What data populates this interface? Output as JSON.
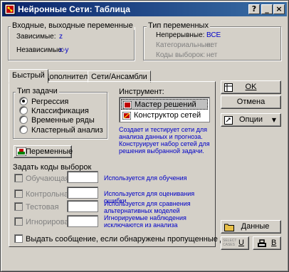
{
  "window": {
    "title": "Нейронные Сети: Таблица",
    "help": "?",
    "minimize": "_",
    "close": "×"
  },
  "variables": {
    "title": "Входные, выходные переменные",
    "dependent_label": "Зависимые:",
    "dependent_value": "z",
    "independent_label": "Независимые:",
    "independent_value": "x-y"
  },
  "var_types": {
    "title": "Тип переменных",
    "continuous_label": "Непрерывные:",
    "continuous_value": "ВСЕ",
    "categorical_label": "Категориальные:",
    "categorical_value": "нет",
    "codes_label": "Коды выборок:",
    "codes_value": "нет"
  },
  "tabs": [
    "Быстрый",
    "Дополнительно",
    "Сети/Ансамбли"
  ],
  "task": {
    "title": "Тип задачи",
    "options": [
      "Регрессия",
      "Классификация",
      "Временные ряды",
      "Кластерный анализ"
    ],
    "selected": "Регрессия"
  },
  "tool": {
    "label": "Инструмент:",
    "items": [
      "Мастер решений",
      "Конструктор сетей"
    ],
    "selected": "Мастер решений",
    "description": "Создает и тестирует сети для анализа данных и прогноза. Конструирует набор сетей для решения выбранной задачи."
  },
  "variables_button": "Переменные",
  "codes": {
    "title": "Задать коды выборок",
    "rows": [
      {
        "label": "Обучающая",
        "hint": "Используется для обучения"
      },
      {
        "label": "Контрольная",
        "hint": "Используется для оценивания ошибки"
      },
      {
        "label": "Тестовая",
        "hint": "Используется для сравнения альтернативных моделей"
      },
      {
        "label": "Игнорировать",
        "hint": "Игнорируемые наблюдения исключаются из анализа"
      }
    ]
  },
  "missing_check": "Выдать сообщение, если обнаружены пропущенные данные",
  "buttons": {
    "ok": "OK",
    "cancel": "Отмена",
    "options": "Опции",
    "data": "Данные",
    "select_cases": "SELECT CASES",
    "u_label": "U",
    "w_label": "B"
  },
  "colors": {
    "title_bar": "#0a246a",
    "face": "#d4d0c8",
    "accent_text": "#0000c8"
  }
}
